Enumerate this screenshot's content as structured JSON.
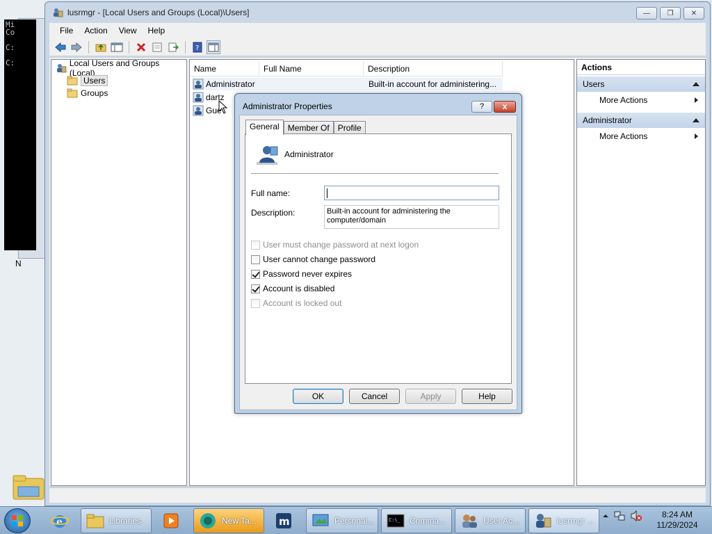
{
  "background": {
    "cmd_lines": "Mi\nCo\n\nC:\n\nC:",
    "desktop_label_n": "N"
  },
  "window": {
    "title": "lusrmgr - [Local Users and Groups (Local)\\Users]",
    "menu": [
      "File",
      "Action",
      "View",
      "Help"
    ]
  },
  "tree": {
    "root": "Local Users and Groups (Local)",
    "items": [
      "Users",
      "Groups"
    ]
  },
  "list": {
    "columns": [
      "Name",
      "Full Name",
      "Description"
    ],
    "rows": [
      {
        "name": "Administrator",
        "full_name": "",
        "description": "Built-in account for administering..."
      },
      {
        "name": "dartz",
        "full_name": "",
        "description": ""
      },
      {
        "name": "Gue",
        "full_name": "",
        "description": ""
      }
    ]
  },
  "actions": {
    "title": "Actions",
    "sections": [
      {
        "label": "Users",
        "item": "More Actions"
      },
      {
        "label": "Administrator",
        "item": "More Actions"
      }
    ]
  },
  "dialog": {
    "title": "Administrator Properties",
    "help_glyph": "?",
    "close_glyph": "x",
    "tabs": [
      "General",
      "Member Of",
      "Profile"
    ],
    "user_name": "Administrator",
    "full_name_label": "Full name:",
    "full_name_value": "",
    "description_label": "Description:",
    "description_value": "Built-in account for administering the computer/domain",
    "checkboxes": [
      {
        "label": "User must change password at next logon",
        "checked": false,
        "disabled": true
      },
      {
        "label": "User cannot change password",
        "checked": false,
        "disabled": false
      },
      {
        "label": "Password never expires",
        "checked": true,
        "disabled": false
      },
      {
        "label": "Account is disabled",
        "checked": true,
        "disabled": false
      },
      {
        "label": "Account is locked out",
        "checked": false,
        "disabled": true
      }
    ],
    "buttons": {
      "ok": "OK",
      "cancel": "Cancel",
      "apply": "Apply",
      "help": "Help"
    }
  },
  "taskbar": {
    "items": [
      {
        "label": "Libraries",
        "icon": "folder-icon"
      },
      {
        "label": "",
        "icon": "media-player-icon"
      },
      {
        "label": "New Ta...",
        "icon": "browser-icon"
      },
      {
        "label": "",
        "icon": "maxthon-icon"
      },
      {
        "label": "Personal...",
        "icon": "personalize-icon"
      },
      {
        "label": "Comma...",
        "icon": "command-prompt-icon"
      },
      {
        "label": "User Ac...",
        "icon": "user-accounts-icon"
      },
      {
        "label": "lusrmgr ...",
        "icon": "lusrmgr-icon"
      }
    ],
    "time": "8:24 AM",
    "date": "11/29/2024"
  },
  "colors": {
    "accent": "#1f5a9b",
    "selection": "#c3d4ea",
    "close_red": "#c5402a"
  }
}
